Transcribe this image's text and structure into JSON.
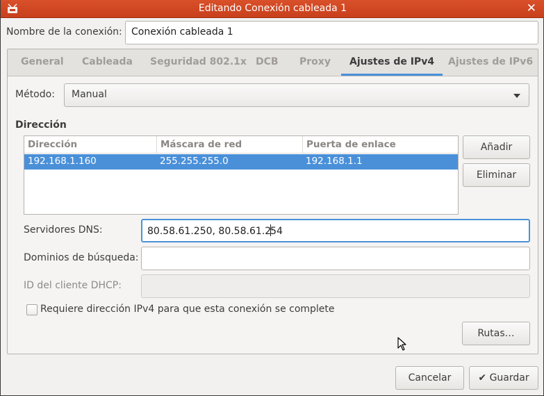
{
  "window": {
    "title": "Editando Conexión cableada 1",
    "close_icon": "close-icon",
    "app_icon": "network-icon"
  },
  "connection": {
    "name_label": "Nombre de la conexión:",
    "name_value": "Conexión cableada 1"
  },
  "tabs": [
    {
      "label": "General"
    },
    {
      "label": "Cableada"
    },
    {
      "label": "Seguridad 802.1x"
    },
    {
      "label": "DCB"
    },
    {
      "label": "Proxy"
    },
    {
      "label": "Ajustes de IPv4",
      "active": true
    },
    {
      "label": "Ajustes de IPv6"
    }
  ],
  "ipv4": {
    "method_label": "Método:",
    "method_value": "Manual",
    "address_section": "Dirección",
    "columns": [
      "Dirección",
      "Máscara de red",
      "Puerta de enlace"
    ],
    "rows": [
      {
        "address": "192.168.1.160",
        "netmask": "255.255.255.0",
        "gateway": "192.168.1.1"
      }
    ],
    "add_label": "Añadir",
    "remove_label": "Eliminar",
    "dns_label": "Servidores DNS:",
    "dns_value_before": "80.58.61.250, 80.58.61.2",
    "dns_value_after": "54",
    "search_label": "Dominios de búsqueda:",
    "search_value": "",
    "dhcp_label": "ID del cliente DHCP:",
    "dhcp_value": "",
    "require_label": "Requiere dirección IPv4 para que esta conexión se complete",
    "require_checked": false,
    "routes_label": "Rutas…"
  },
  "footer": {
    "cancel_label": "Cancelar",
    "save_label": "Guardar",
    "save_icon": "checkmark-icon"
  },
  "colors": {
    "titlebar": "#d9502a",
    "accent": "#4a90d9"
  }
}
